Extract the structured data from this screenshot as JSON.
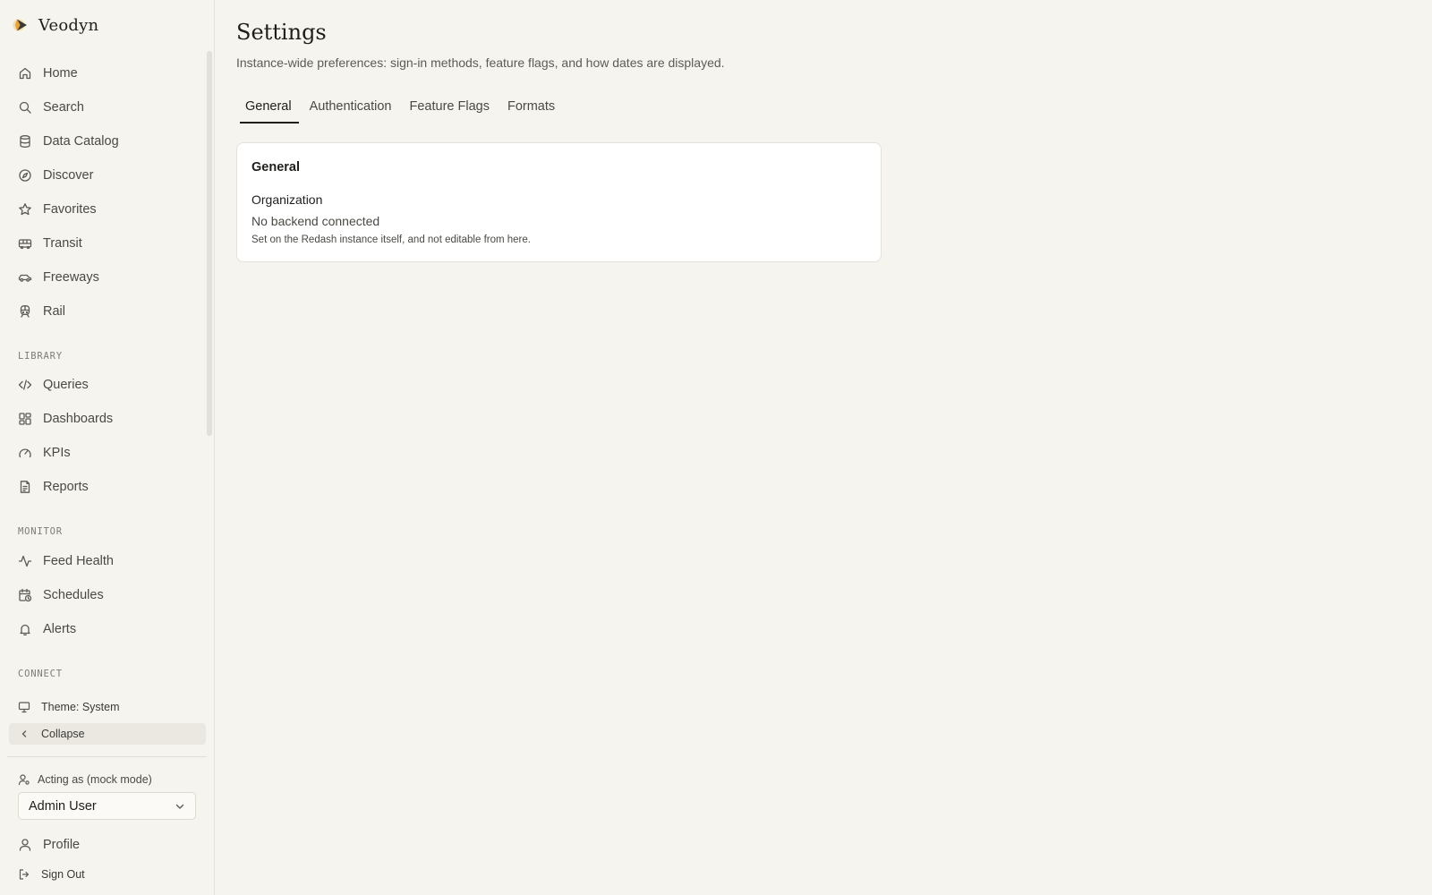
{
  "app": {
    "name": "Veodyn"
  },
  "sidebar": {
    "nav": [
      {
        "label": "Home",
        "icon": "home-icon"
      },
      {
        "label": "Search",
        "icon": "search-icon"
      },
      {
        "label": "Data Catalog",
        "icon": "database-icon"
      },
      {
        "label": "Discover",
        "icon": "compass-icon"
      },
      {
        "label": "Favorites",
        "icon": "star-icon"
      },
      {
        "label": "Transit",
        "icon": "bus-icon"
      },
      {
        "label": "Freeways",
        "icon": "car-icon"
      },
      {
        "label": "Rail",
        "icon": "train-icon"
      }
    ],
    "library": {
      "label": "LIBRARY",
      "items": [
        {
          "label": "Queries",
          "icon": "code-icon"
        },
        {
          "label": "Dashboards",
          "icon": "grid-icon"
        },
        {
          "label": "KPIs",
          "icon": "gauge-icon"
        },
        {
          "label": "Reports",
          "icon": "file-text-icon"
        }
      ]
    },
    "monitor": {
      "label": "MONITOR",
      "items": [
        {
          "label": "Feed Health",
          "icon": "activity-icon"
        },
        {
          "label": "Schedules",
          "icon": "calendar-clock-icon"
        },
        {
          "label": "Alerts",
          "icon": "bell-icon"
        }
      ]
    },
    "connect": {
      "label": "CONNECT"
    },
    "theme_label": "Theme: System",
    "collapse_label": "Collapse",
    "acting_label": "Acting as (mock mode)",
    "acting_user": "Admin User",
    "profile_label": "Profile",
    "signout_label": "Sign Out"
  },
  "page": {
    "title": "Settings",
    "subtitle": "Instance-wide preferences: sign-in methods, feature flags, and how dates are displayed.",
    "tabs": [
      "General",
      "Authentication",
      "Feature Flags",
      "Formats"
    ],
    "active_tab": "General"
  },
  "card": {
    "title": "General",
    "field_label": "Organization",
    "field_value": "No backend connected",
    "field_help": "Set on the Redash instance itself, and not editable from here."
  },
  "colors": {
    "background": "#f5f4ef",
    "card": "#ffffff",
    "text": "#1f1e1b",
    "muted": "#5c5b56",
    "logo_orange": "#e8a13a",
    "logo_dark": "#3a3935"
  }
}
